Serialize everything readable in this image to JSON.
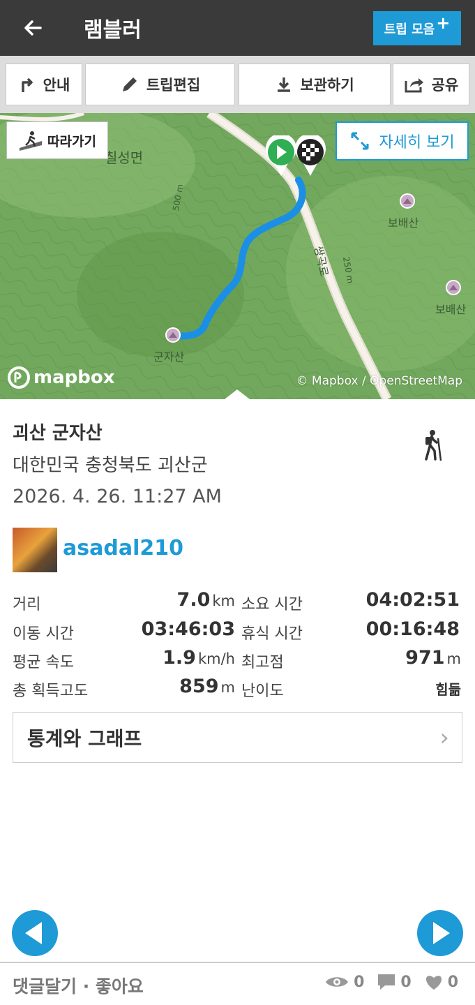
{
  "appbar": {
    "title": "램블러",
    "trip_collection_label": "트립 모음",
    "trip_collection_plus": "+"
  },
  "toolbar": {
    "guide_label": "안내",
    "edit_label": "트립편집",
    "save_label": "보관하기",
    "share_label": "공유"
  },
  "map": {
    "follow_label": "따라가기",
    "detail_label": "자세히 보기",
    "labels": {
      "town": "칠성면",
      "peak1": "보배산",
      "peak2": "보배산",
      "summit": "군자산",
      "road": "쌍곡로",
      "contour1": "500 m",
      "contour2": "250 m"
    },
    "attribution": "© Mapbox / OpenStreetMap",
    "logo": "mapbox"
  },
  "trip": {
    "name": "괴산 군자산",
    "location": "대한민국 충청북도 괴산군",
    "date": "2026. 4. 26. 11:27 AM",
    "user": "asadal210"
  },
  "stats": {
    "distance": {
      "label": "거리",
      "value": "7.0",
      "unit": "km"
    },
    "total_time": {
      "label": "소요 시간",
      "value": "04:02:51"
    },
    "moving_time": {
      "label": "이동 시간",
      "value": "03:46:03"
    },
    "rest_time": {
      "label": "휴식 시간",
      "value": "00:16:48"
    },
    "avg_speed": {
      "label": "평균 속도",
      "value": "1.9",
      "unit": "km/h"
    },
    "max_elevation": {
      "label": "최고점",
      "value": "971",
      "unit": "m"
    },
    "elevation_gain": {
      "label": "총 획득고도",
      "value": "859",
      "unit": "m"
    },
    "difficulty": {
      "label": "난이도",
      "value": "힘듦"
    }
  },
  "graph_button": {
    "label": "통계와 그래프",
    "chevron": "›"
  },
  "bottom": {
    "comment_like": "댓글달기 · 좋아요",
    "views": "0",
    "comments": "0",
    "likes": "0"
  },
  "colors": {
    "accent": "#1e9ad6",
    "appbar": "#3a3a3a",
    "route": "#1b8fe6"
  }
}
